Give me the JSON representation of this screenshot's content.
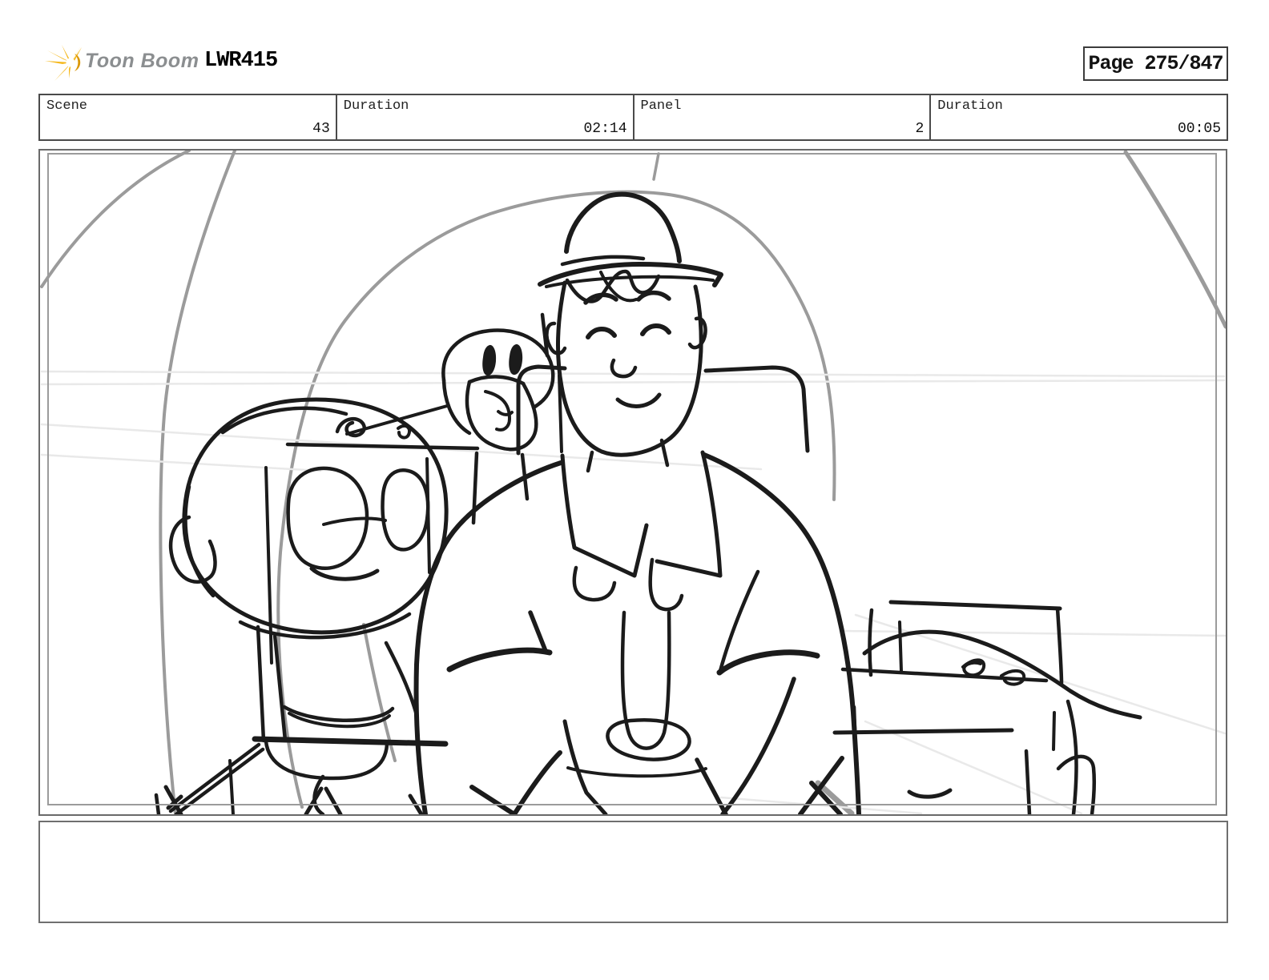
{
  "logo": {
    "brand": "Toon Boom",
    "icon": "starburst-icon",
    "accent_color": "#F5B81C"
  },
  "header": {
    "title": "LWR415",
    "page_label": "Page 275/847"
  },
  "fields": [
    {
      "label": "Scene",
      "value": "43"
    },
    {
      "label": "Duration",
      "value": "02:14"
    },
    {
      "label": "Panel",
      "value": "2"
    },
    {
      "label": "Duration",
      "value": "00:05"
    }
  ],
  "panel": {
    "content": "storyboard-sketch",
    "description": "rough pencil sketch of smiling man in cap seated between a scribbly-haired kid with glasses and a bird, sleeping figure at right"
  },
  "caption": {
    "text": ""
  },
  "colors": {
    "sketch_ink": "#1b1b1b",
    "construction_gray": "#9b9b9b",
    "frame_gray": "#9b9b9b",
    "border_dark": "#4a4a4a"
  }
}
